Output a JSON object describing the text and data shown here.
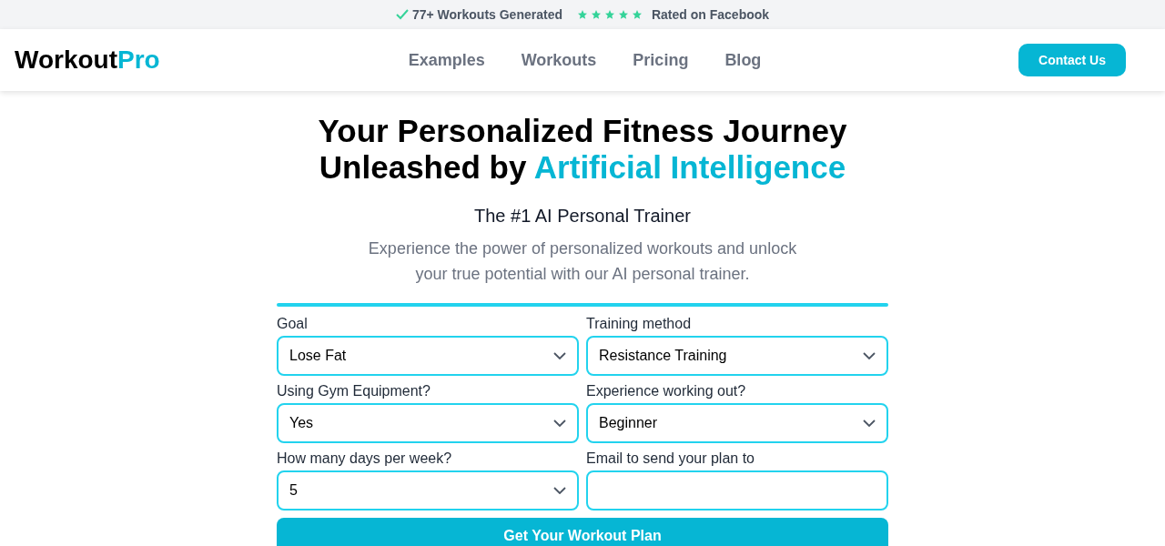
{
  "top_bar": {
    "workouts_generated": "77+ Workouts Generated",
    "stars": 5,
    "rating_text": "Rated on Facebook"
  },
  "header": {
    "logo": {
      "main": "Workout",
      "accent": "Pro"
    },
    "nav": [
      "Examples",
      "Workouts",
      "Pricing",
      "Blog"
    ],
    "contact_button": "Contact Us"
  },
  "hero": {
    "heading": "Your Personalized Fitness Journey Unleashed by",
    "heading_accent": "Artificial Intelligence",
    "subtitle": "The #1 AI Personal Trainer",
    "description": "Experience the power of personalized workouts and unlock your true potential with our AI personal trainer."
  },
  "form": {
    "fields": [
      {
        "kind": "select",
        "label": "Goal",
        "value": "Lose Fat"
      },
      {
        "kind": "select",
        "label": "Training method",
        "value": "Resistance Training"
      },
      {
        "kind": "select",
        "label": "Using Gym Equipment?",
        "value": "Yes"
      },
      {
        "kind": "select",
        "label": "Experience working out?",
        "value": "Beginner"
      },
      {
        "kind": "select",
        "label": "How many days per week?",
        "value": "5"
      },
      {
        "kind": "email",
        "label": "Email to send your plan to"
      }
    ],
    "submit": "Get Your Workout Plan"
  }
}
